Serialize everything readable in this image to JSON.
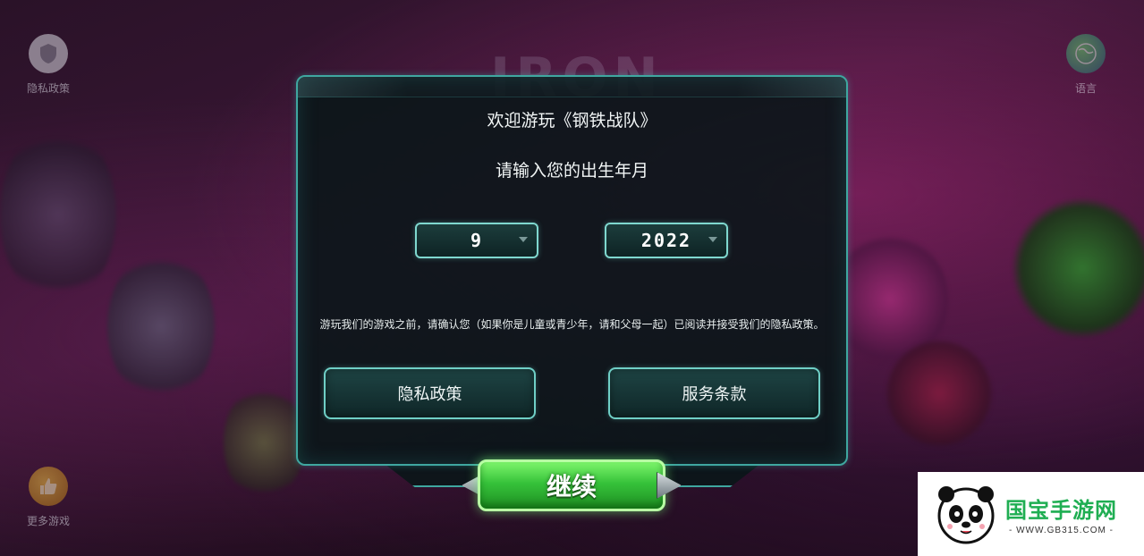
{
  "corners": {
    "privacy_label": "隐私政策",
    "language_label": "语言",
    "more_games_label": "更多游戏"
  },
  "background": {
    "logo_text": "IRON"
  },
  "dialog": {
    "welcome": "欢迎游玩《钢铁战队》",
    "prompt": "请输入您的出生年月",
    "month_value": "9",
    "year_value": "2022",
    "consent": "游玩我们的游戏之前，请确认您（如果你是儿童或青少年，请和父母一起）已阅读并接受我们的隐私政策。",
    "privacy_button": "隐私政策",
    "terms_button": "服务条款",
    "continue_button": "继续"
  },
  "watermark": {
    "title": "国宝手游网",
    "url": "- WWW.GB315.COM -"
  },
  "colors": {
    "accent": "#3fa7a0",
    "continue_green": "#36c23a",
    "watermark_green": "#1fae52"
  }
}
